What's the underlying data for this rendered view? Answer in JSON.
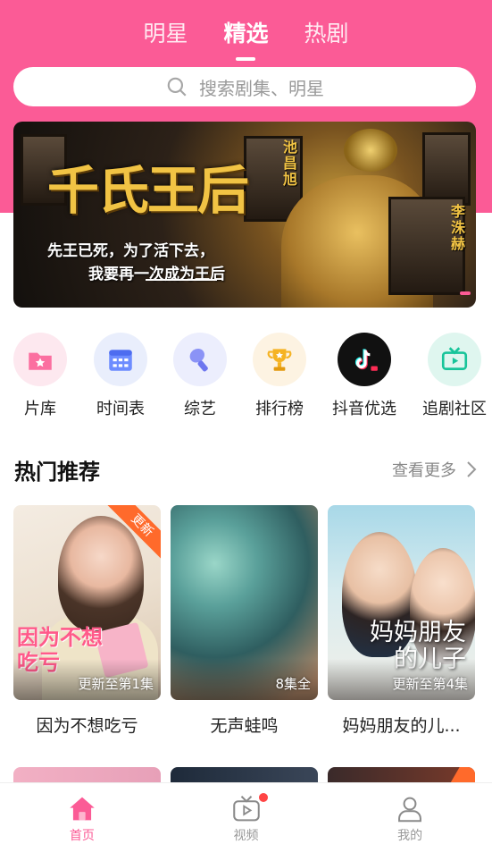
{
  "colors": {
    "accent": "#fb5b96",
    "badge": "#ff6a2b",
    "notify": "#ff4444"
  },
  "top_tabs": [
    {
      "label": "明星",
      "active": false
    },
    {
      "label": "精选",
      "active": true
    },
    {
      "label": "热剧",
      "active": false
    }
  ],
  "search": {
    "placeholder": "搜索剧集、明星",
    "icon": "search-icon"
  },
  "banner": {
    "title": "千氏王后",
    "subtitle_line1": "先王已死，为了活下去，",
    "subtitle_line2": "我要再一次成为王后",
    "actor_1": "池昌旭",
    "actor_2": "李洙赫"
  },
  "categories": [
    {
      "label": "片库",
      "icon": "folder-star-icon",
      "color": "#fb5b96"
    },
    {
      "label": "时间表",
      "icon": "calendar-icon",
      "color": "#6d8cff"
    },
    {
      "label": "综艺",
      "icon": "variety-icon",
      "color": "#7b85f5"
    },
    {
      "label": "排行榜",
      "icon": "trophy-icon",
      "color": "#f5b323"
    },
    {
      "label": "抖音优选",
      "icon": "douyin-icon",
      "color": "#111111"
    },
    {
      "label": "追剧社区",
      "icon": "tv-icon",
      "color": "#18c49a"
    }
  ],
  "hot": {
    "title": "热门推荐",
    "more": "查看更多",
    "items": [
      {
        "title": "因为不想吃亏",
        "caption": "更新至第1集",
        "badge": "更新",
        "poster_text": "因为不想\n吃亏"
      },
      {
        "title": "无声蛙鸣",
        "caption": "8集全",
        "badge": "",
        "poster_text": ""
      },
      {
        "title": "妈妈朋友的儿...",
        "caption": "更新至第4集",
        "badge": "",
        "poster_text": "妈妈朋友\n的儿子"
      }
    ]
  },
  "tabbar": [
    {
      "label": "首页",
      "icon": "home-icon",
      "active": true
    },
    {
      "label": "视频",
      "icon": "video-icon",
      "active": false,
      "has_notification": true
    },
    {
      "label": "我的",
      "icon": "profile-icon",
      "active": false
    }
  ]
}
